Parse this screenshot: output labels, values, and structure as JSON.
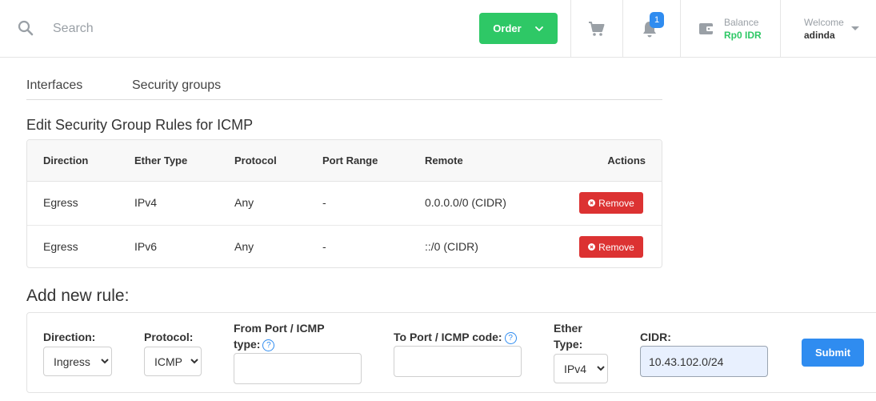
{
  "header": {
    "search_placeholder": "Search",
    "order_label": "Order",
    "notifications_count": "1",
    "balance_label": "Balance",
    "balance_value": "Rp0 IDR",
    "welcome_label": "Welcome",
    "username": "adinda"
  },
  "tabs": [
    {
      "label": "Interfaces"
    },
    {
      "label": "Security groups"
    }
  ],
  "rules_title": "Edit Security Group Rules for ICMP",
  "rules_table": {
    "headers": {
      "direction": "Direction",
      "ether_type": "Ether Type",
      "protocol": "Protocol",
      "port_range": "Port Range",
      "remote": "Remote",
      "actions": "Actions"
    },
    "rows": [
      {
        "direction": "Egress",
        "ether_type": "IPv4",
        "protocol": "Any",
        "port_range": "-",
        "remote": "0.0.0.0/0 (CIDR)",
        "action_label": "Remove"
      },
      {
        "direction": "Egress",
        "ether_type": "IPv6",
        "protocol": "Any",
        "port_range": "-",
        "remote": "::/0 (CIDR)",
        "action_label": "Remove"
      }
    ]
  },
  "add_rule": {
    "title": "Add new rule:",
    "direction_label": "Direction:",
    "direction_value": "Ingress",
    "protocol_label": "Protocol:",
    "protocol_value": "ICMP",
    "from_port_label_line1": "From Port / ICMP",
    "from_port_label_line2": "type:",
    "from_port_value": "",
    "to_port_label": "To Port / ICMP code:",
    "to_port_value": "",
    "ether_type_label_line1": "Ether",
    "ether_type_label_line2": "Type:",
    "ether_type_value": "IPv4",
    "cidr_label": "CIDR:",
    "cidr_value": "10.43.102.0/24",
    "help_glyph": "?",
    "submit_label": "Submit"
  },
  "colors": {
    "accent_green": "#2ec866",
    "accent_blue": "#2f8cf0",
    "danger_red": "#dc3232"
  }
}
